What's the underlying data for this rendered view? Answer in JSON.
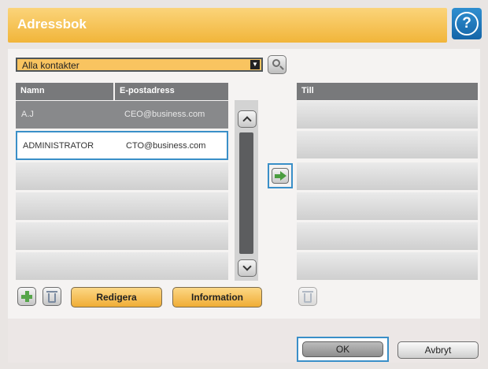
{
  "window": {
    "title": "Adressbok"
  },
  "help": {
    "glyph": "?"
  },
  "filter": {
    "selected": "Alla kontakter"
  },
  "contacts": {
    "headers": {
      "name": "Namn",
      "email": "E-postadress"
    },
    "rows": [
      {
        "name": "A.J",
        "email": "CEO@business.com"
      },
      {
        "name": "ADMINISTRATOR",
        "email": "CTO@business.com"
      }
    ]
  },
  "recipients": {
    "header": "Till"
  },
  "actions": {
    "edit_label": "Redigera",
    "info_label": "Information"
  },
  "footer": {
    "ok_label": "OK",
    "cancel_label": "Avbryt"
  },
  "icons": {
    "help": "help-icon",
    "search": "search-icon",
    "scroll_up": "chevron-up-icon",
    "scroll_down": "chevron-down-icon",
    "move_to": "arrow-right-icon",
    "add": "plus-icon",
    "delete": "trash-icon"
  },
  "colors": {
    "accent": "#f1b53a",
    "help": "#1565a8",
    "selection": "#3a8fc8",
    "header": "#78797b"
  }
}
